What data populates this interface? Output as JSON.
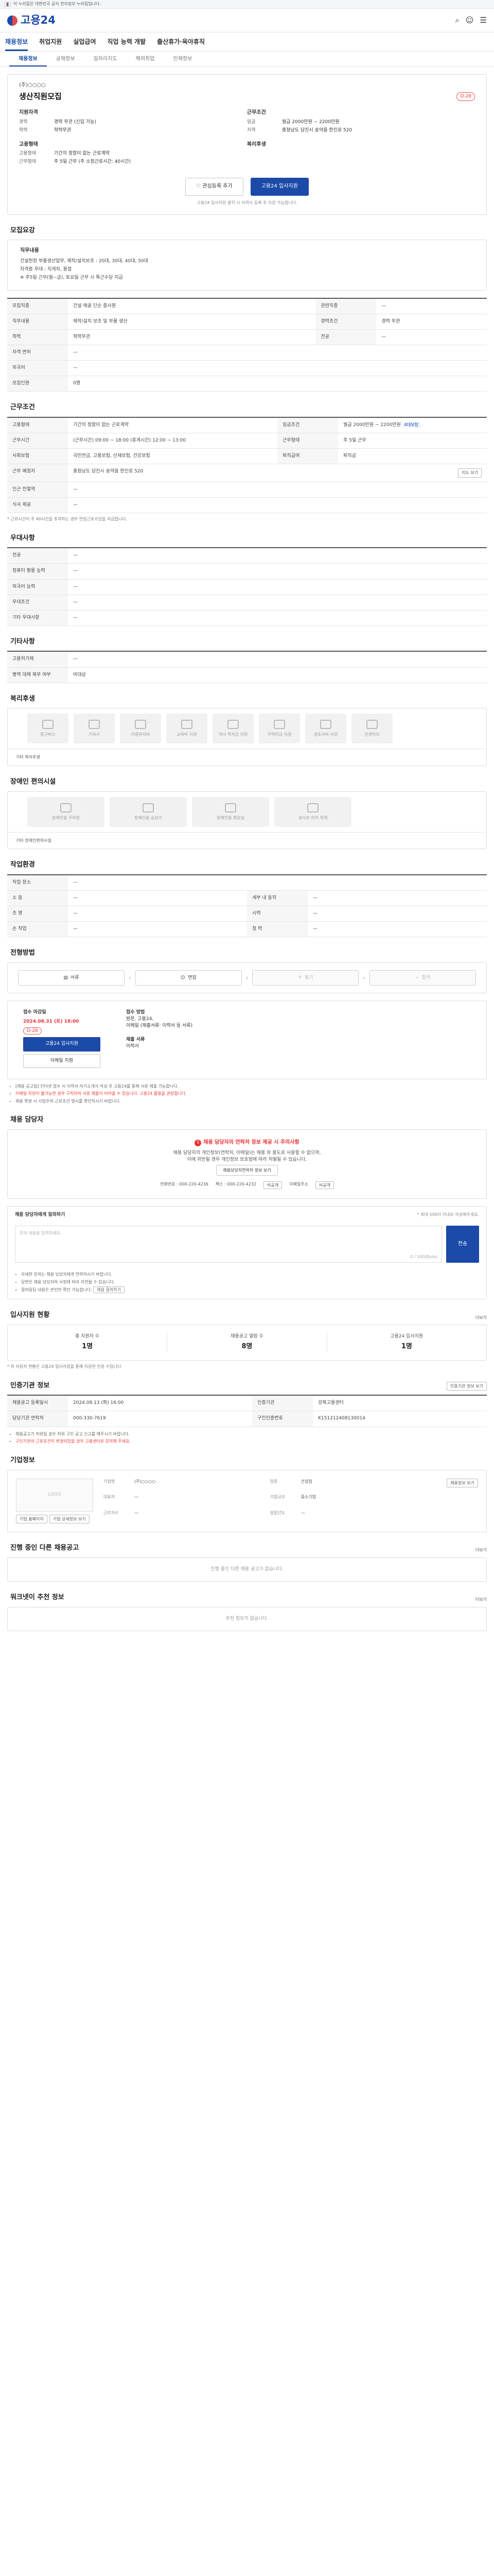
{
  "gov_bar": {
    "text": "이 누리집은 대한민국 공식 전자정부 누리집입니다."
  },
  "header": {
    "logo_text": "고용24"
  },
  "gnb": [
    "채용정보",
    "취업지원",
    "실업급여",
    "직업 능력 개발",
    "출산휴가·육아휴직"
  ],
  "sub_tabs": [
    "채용정보",
    "공채정보",
    "일자리지도",
    "해외취업",
    "인재정보"
  ],
  "posting": {
    "company": "(주)○○○○",
    "title": "생산직원모집",
    "dday": "D-28",
    "qual_label": "지원자격",
    "qual": [
      {
        "k": "경력",
        "v": "경력 무관 (신입 가능)"
      },
      {
        "k": "학력",
        "v": "학력무관"
      }
    ],
    "cond_label": "근무조건",
    "cond": [
      {
        "k": "임금",
        "v": "월급 2000만원 ~ 2200만원"
      },
      {
        "k": "지역",
        "v": "충청남도 당진시 송악읍 한진로 520"
      }
    ],
    "form_label": "고용형태",
    "form": [
      {
        "k": "고용형태",
        "v": "기간의 정함이 없는 근로계약"
      },
      {
        "k": "근무형태",
        "v": "주 5일 근무 (주 소정근로시간: 40시간)"
      }
    ],
    "welfare_label": "복리후생",
    "scrap_btn": "관심등록 추가",
    "apply_btn": "고용24 입사지원",
    "note": "고용24 입사지원 클릭 시 이력서 등록 후 지원 가능합니다."
  },
  "duty": {
    "title": "모집요강",
    "h": "직무내용",
    "lines": [
      "건설현장 부품생산업무, 제작/설치보조 : 20대, 30대, 40대, 50대",
      "자격증 우대 : 지게차, 용접",
      "※ 주5일 근무(월~금), 토요일 근무 시 특근수당 지급"
    ]
  },
  "recruit": {
    "rows": [
      {
        "k": "모집직종",
        "v": "건설·채굴 단순 종사원",
        "k2": "관련직종",
        "v2": "—"
      },
      {
        "k": "직무내용",
        "v": "제작/설치 보조 및 부품 생산",
        "k2": "경력조건",
        "v2": "경력 무관"
      },
      {
        "k": "학력",
        "v": "학력무관",
        "k2": "전공",
        "v2": "—"
      },
      {
        "k": "자격 면허",
        "v": "—",
        "k2": "",
        "v2": ""
      },
      {
        "k": "외국어",
        "v": "—",
        "k2": "",
        "v2": ""
      },
      {
        "k": "모집인원",
        "v": "0명",
        "k2": "",
        "v2": ""
      }
    ]
  },
  "conditions": {
    "title": "근무조건",
    "rows": [
      {
        "k": "고용형태",
        "v": "기간의 정함이 없는 근로계약",
        "k2": "임금조건",
        "v2": "월급 2000만원 ~ 2200만원"
      },
      {
        "k": "근무시간",
        "v": "(근무시간) 09:00 ~ 18:00  (휴게시간) 12:00 ~ 13:00",
        "k2": "근무형태",
        "v2": "주 5일 근무"
      },
      {
        "k": "사회보험",
        "v": "국민연금, 고용보험, 산재보험, 건강보험",
        "k2": "퇴직급여",
        "v2": "퇴직금"
      },
      {
        "k": "근무 예정지",
        "v": "충청남도 당진시 송악읍 한진로 520",
        "k2": "",
        "v2": ""
      },
      {
        "k": "인근 전철역",
        "v": "—",
        "k2": "",
        "v2": ""
      },
      {
        "k": "식사 제공",
        "v": "—",
        "k2": "",
        "v2": ""
      }
    ],
    "overtime_tag": "4대보험",
    "map_btn": "지도 보기",
    "note": "* 근로시간이 주 40시간을 초과하는 경우 연장근로수당을 지급합니다."
  },
  "priority": {
    "title": "우대사항",
    "rows": [
      {
        "k": "전공",
        "v": "—"
      },
      {
        "k": "컴퓨터 활용 능력",
        "v": "—"
      },
      {
        "k": "외국어 능력",
        "v": "—"
      },
      {
        "k": "우대조건",
        "v": "—"
      },
      {
        "k": "기타 우대사항",
        "v": "—"
      }
    ]
  },
  "etc": {
    "title": "기타사항",
    "rows": [
      {
        "k": "고용허가제",
        "v": "—"
      },
      {
        "k": "병역 대체 복무 여부",
        "v": "비대상"
      }
    ]
  },
  "benefit": {
    "title": "복리후생",
    "ext_text": "기타 복리후생"
  },
  "welfare": {
    "tiles": [
      "통근버스",
      "기숙사",
      "차량유지비",
      "교육비 지원",
      "자녀 학자금 지원",
      "주택자금 지원",
      "경조사비 지원",
      "인센티브"
    ]
  },
  "disability": {
    "title": "장애인 편의시설",
    "tiles": [
      "장애인용 주차장",
      "장애인용 승강기",
      "장애인용 화장실",
      "경사로 의자 목개"
    ],
    "ext_text": "기타 장애인편의시설"
  },
  "environment": {
    "title": "작업환경",
    "rows": [
      {
        "k": "작업 장소",
        "v": "—",
        "k2": "",
        "v2": ""
      },
      {
        "k": "소 음",
        "v": "—",
        "k2": "세부 내 동작",
        "v2": "—"
      },
      {
        "k": "조 명",
        "v": "—",
        "k2": "시력",
        "v2": "—"
      },
      {
        "k": "손 작업",
        "v": "—",
        "k2": "청 력",
        "v2": "—"
      }
    ]
  },
  "process": {
    "title": "전형방법",
    "steps": [
      "서류",
      "면접",
      "필기",
      "합격"
    ]
  },
  "apply": {
    "left_title": "접수 마감일",
    "date": "2024.08.31 (토) 18:00",
    "dday": "D-28",
    "btn1": "고용24 입사지원",
    "btn2": "이메일 지원",
    "right_title": "접수 방법",
    "method": "방문, 고용24,",
    "method2": "이메일 (제출서류: 이력서 등 서류)",
    "docs_title": "제출 서류",
    "docs": "이력서"
  },
  "apply_notes": [
    "[채용 공고일] 인터넷 접수 시 이력서·자기소개서 작성 후 고용24를 통해 서류 제출 가능합니다.",
    "이메일 지원이 불가능한 경우 구직자의 서류 제출이 어려울 수 있습니다. 고용24 활용을 권장합니다.",
    "채용 확정 시 사업주의 근로조건 명시를 확인하시기 바랍니다."
  ],
  "contact": {
    "title": "채용 담당자",
    "warn_title": "채용 담당자의 연락처 정보 제공 시 주의사항",
    "warn1": "채용 담당자의 개인정보(연락처, 이메일)는 채용 외 용도로 사용할 수 없으며,",
    "warn2": "이에 위반될 경우 개인정보 보호법에 따라 처벌될 수 있습니다.",
    "show_btn": "채용담당자연락처 정보 보기",
    "tel": "전화번호 : 000-220-4236",
    "fax": "팩스 : 000-220-4232",
    "email": "이메일주소",
    "hide1": "비공개",
    "hide2": "비공개"
  },
  "inquiry": {
    "title": "채용 담당자에게 질의하기",
    "limit": "* 최대 500자 이내로 작성해주세요.",
    "placeholder": "문의 내용을 입력하세요.",
    "count": "0 / 500(Byte)",
    "send": "전송",
    "notes": [
      "자세한 문의는 채용 담당자에게 연락하시기 바랍니다.",
      "답변은 채용 담당자의 사정에 따라 지연될 수 있습니다.",
      "질의응답 내용은 본인만 확인 가능합니다."
    ],
    "link_btn": "채용 질의하기"
  },
  "stats": {
    "title": "입사지원 현황",
    "more": "더보기",
    "items": [
      {
        "label": "총 지원자 수",
        "value": "1명"
      },
      {
        "label": "채용공고 열람 수",
        "value": "8명"
      },
      {
        "label": "고용24 입사지원",
        "value": "1명"
      }
    ],
    "note": "* 위 지원자 현황은 고용24 입사지원을 통해 지원한 인원 수입니다."
  },
  "agency": {
    "title": "인증기관 정보",
    "pdf_btn": "인증기관 정보 보기",
    "rows": [
      {
        "k": "채용공고 등록일시",
        "v": "2024.08.13 (화) 16:00",
        "k2": "인증기관",
        "v2": "강북고용센터"
      },
      {
        "k": "담당기관 연락처",
        "v": "000-330-7619",
        "k2": "구인인증번호",
        "v2": "K151212408130014"
      }
    ],
    "notes": [
      "채용공고가 허위일 경우 허위 구인 공고 신고를 해주시기 바랍니다.",
      "구인기관의 근로조건이 변경되었을 경우 고용센터로 문의해 주세요."
    ]
  },
  "company": {
    "title": "기업정보",
    "logo": "LOGO",
    "btn1": "기업 홈페이지",
    "btn2": "기업 상세정보 보기",
    "info": [
      {
        "k": "기업명",
        "v": "(주)○○○○"
      },
      {
        "k": "업종",
        "v": "건설업"
      },
      {
        "k": "대표자",
        "v": "—"
      },
      {
        "k": "기업규모",
        "v": "중소기업"
      },
      {
        "k": "근로자수",
        "v": "—"
      },
      {
        "k": "설립년도",
        "v": "—"
      }
    ],
    "detail_btn": "채용정보 보기"
  },
  "others": {
    "title": "진행 중인 다른 채용공고",
    "more": "더보기",
    "empty": "진행 중인 다른 채용 공고가 없습니다."
  },
  "recommend": {
    "title": "워크넷이 추천 정보",
    "more": "더보기",
    "empty": "추천 정보가 없습니다."
  }
}
